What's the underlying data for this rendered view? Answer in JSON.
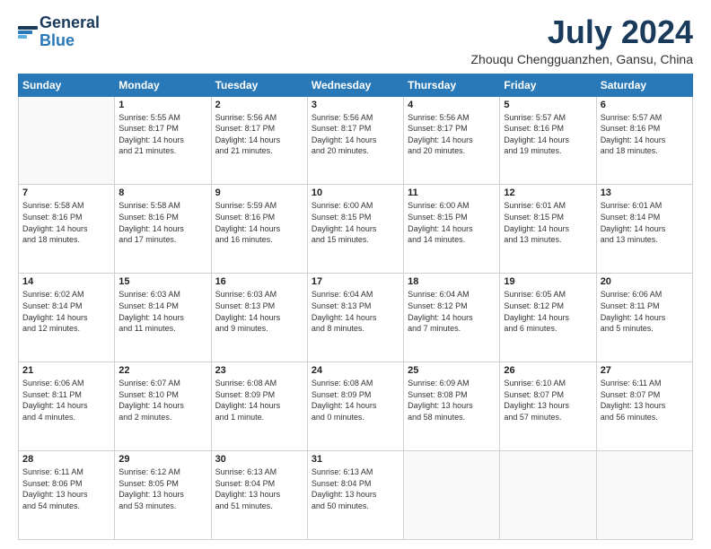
{
  "header": {
    "logo_line1": "General",
    "logo_line2": "Blue",
    "month_title": "July 2024",
    "location": "Zhouqu Chengguanzhen, Gansu, China"
  },
  "days_of_week": [
    "Sunday",
    "Monday",
    "Tuesday",
    "Wednesday",
    "Thursday",
    "Friday",
    "Saturday"
  ],
  "weeks": [
    [
      {
        "day": "",
        "info": ""
      },
      {
        "day": "1",
        "info": "Sunrise: 5:55 AM\nSunset: 8:17 PM\nDaylight: 14 hours\nand 21 minutes."
      },
      {
        "day": "2",
        "info": "Sunrise: 5:56 AM\nSunset: 8:17 PM\nDaylight: 14 hours\nand 21 minutes."
      },
      {
        "day": "3",
        "info": "Sunrise: 5:56 AM\nSunset: 8:17 PM\nDaylight: 14 hours\nand 20 minutes."
      },
      {
        "day": "4",
        "info": "Sunrise: 5:56 AM\nSunset: 8:17 PM\nDaylight: 14 hours\nand 20 minutes."
      },
      {
        "day": "5",
        "info": "Sunrise: 5:57 AM\nSunset: 8:16 PM\nDaylight: 14 hours\nand 19 minutes."
      },
      {
        "day": "6",
        "info": "Sunrise: 5:57 AM\nSunset: 8:16 PM\nDaylight: 14 hours\nand 18 minutes."
      }
    ],
    [
      {
        "day": "7",
        "info": "Sunrise: 5:58 AM\nSunset: 8:16 PM\nDaylight: 14 hours\nand 18 minutes."
      },
      {
        "day": "8",
        "info": "Sunrise: 5:58 AM\nSunset: 8:16 PM\nDaylight: 14 hours\nand 17 minutes."
      },
      {
        "day": "9",
        "info": "Sunrise: 5:59 AM\nSunset: 8:16 PM\nDaylight: 14 hours\nand 16 minutes."
      },
      {
        "day": "10",
        "info": "Sunrise: 6:00 AM\nSunset: 8:15 PM\nDaylight: 14 hours\nand 15 minutes."
      },
      {
        "day": "11",
        "info": "Sunrise: 6:00 AM\nSunset: 8:15 PM\nDaylight: 14 hours\nand 14 minutes."
      },
      {
        "day": "12",
        "info": "Sunrise: 6:01 AM\nSunset: 8:15 PM\nDaylight: 14 hours\nand 13 minutes."
      },
      {
        "day": "13",
        "info": "Sunrise: 6:01 AM\nSunset: 8:14 PM\nDaylight: 14 hours\nand 13 minutes."
      }
    ],
    [
      {
        "day": "14",
        "info": "Sunrise: 6:02 AM\nSunset: 8:14 PM\nDaylight: 14 hours\nand 12 minutes."
      },
      {
        "day": "15",
        "info": "Sunrise: 6:03 AM\nSunset: 8:14 PM\nDaylight: 14 hours\nand 11 minutes."
      },
      {
        "day": "16",
        "info": "Sunrise: 6:03 AM\nSunset: 8:13 PM\nDaylight: 14 hours\nand 9 minutes."
      },
      {
        "day": "17",
        "info": "Sunrise: 6:04 AM\nSunset: 8:13 PM\nDaylight: 14 hours\nand 8 minutes."
      },
      {
        "day": "18",
        "info": "Sunrise: 6:04 AM\nSunset: 8:12 PM\nDaylight: 14 hours\nand 7 minutes."
      },
      {
        "day": "19",
        "info": "Sunrise: 6:05 AM\nSunset: 8:12 PM\nDaylight: 14 hours\nand 6 minutes."
      },
      {
        "day": "20",
        "info": "Sunrise: 6:06 AM\nSunset: 8:11 PM\nDaylight: 14 hours\nand 5 minutes."
      }
    ],
    [
      {
        "day": "21",
        "info": "Sunrise: 6:06 AM\nSunset: 8:11 PM\nDaylight: 14 hours\nand 4 minutes."
      },
      {
        "day": "22",
        "info": "Sunrise: 6:07 AM\nSunset: 8:10 PM\nDaylight: 14 hours\nand 2 minutes."
      },
      {
        "day": "23",
        "info": "Sunrise: 6:08 AM\nSunset: 8:09 PM\nDaylight: 14 hours\nand 1 minute."
      },
      {
        "day": "24",
        "info": "Sunrise: 6:08 AM\nSunset: 8:09 PM\nDaylight: 14 hours\nand 0 minutes."
      },
      {
        "day": "25",
        "info": "Sunrise: 6:09 AM\nSunset: 8:08 PM\nDaylight: 13 hours\nand 58 minutes."
      },
      {
        "day": "26",
        "info": "Sunrise: 6:10 AM\nSunset: 8:07 PM\nDaylight: 13 hours\nand 57 minutes."
      },
      {
        "day": "27",
        "info": "Sunrise: 6:11 AM\nSunset: 8:07 PM\nDaylight: 13 hours\nand 56 minutes."
      }
    ],
    [
      {
        "day": "28",
        "info": "Sunrise: 6:11 AM\nSunset: 8:06 PM\nDaylight: 13 hours\nand 54 minutes."
      },
      {
        "day": "29",
        "info": "Sunrise: 6:12 AM\nSunset: 8:05 PM\nDaylight: 13 hours\nand 53 minutes."
      },
      {
        "day": "30",
        "info": "Sunrise: 6:13 AM\nSunset: 8:04 PM\nDaylight: 13 hours\nand 51 minutes."
      },
      {
        "day": "31",
        "info": "Sunrise: 6:13 AM\nSunset: 8:04 PM\nDaylight: 13 hours\nand 50 minutes."
      },
      {
        "day": "",
        "info": ""
      },
      {
        "day": "",
        "info": ""
      },
      {
        "day": "",
        "info": ""
      }
    ]
  ]
}
